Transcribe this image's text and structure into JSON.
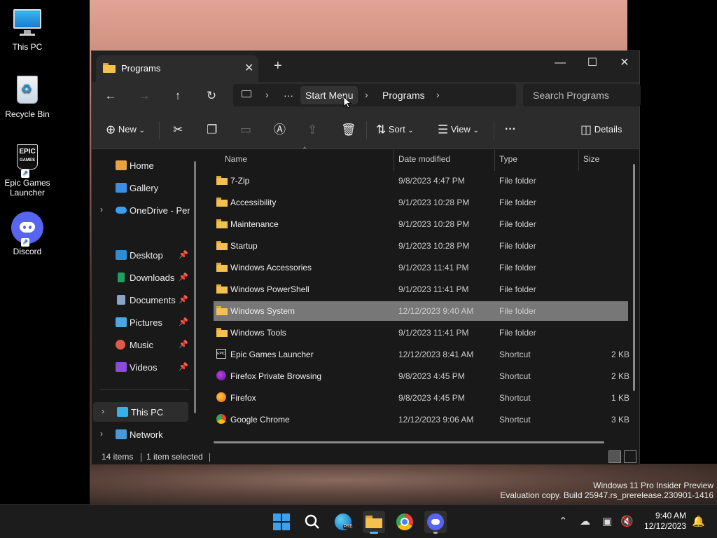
{
  "desktop": {
    "icons": [
      {
        "label": "This PC"
      },
      {
        "label": "Recycle Bin"
      },
      {
        "label": "Epic Games Launcher"
      },
      {
        "label": "Discord"
      }
    ]
  },
  "window": {
    "tab_title": "Programs",
    "new_tab": "+",
    "controls": {
      "minimize": "—",
      "maximize": "☐",
      "close": "✕"
    },
    "address": {
      "ellipsis": "···",
      "segments": [
        "Start Menu",
        "Programs"
      ]
    },
    "search_placeholder": "Search Programs",
    "toolbar": {
      "new_label": "New",
      "sort_label": "Sort",
      "view_label": "View",
      "more_label": "···",
      "details_label": "Details"
    },
    "nav": {
      "quick": [
        {
          "label": "Home"
        },
        {
          "label": "Gallery"
        },
        {
          "label": "OneDrive - Personal"
        }
      ],
      "pinned": [
        {
          "label": "Desktop"
        },
        {
          "label": "Downloads"
        },
        {
          "label": "Documents"
        },
        {
          "label": "Pictures"
        },
        {
          "label": "Music"
        },
        {
          "label": "Videos"
        }
      ],
      "devices": [
        {
          "label": "This PC"
        },
        {
          "label": "Network"
        }
      ]
    },
    "columns": {
      "name": "Name",
      "date": "Date modified",
      "type": "Type",
      "size": "Size"
    },
    "files": [
      {
        "name": "7-Zip",
        "date": "9/8/2023 4:47 PM",
        "type": "File folder",
        "size": ""
      },
      {
        "name": "Accessibility",
        "date": "9/1/2023 10:28 PM",
        "type": "File folder",
        "size": ""
      },
      {
        "name": "Maintenance",
        "date": "9/1/2023 10:28 PM",
        "type": "File folder",
        "size": ""
      },
      {
        "name": "Startup",
        "date": "9/1/2023 10:28 PM",
        "type": "File folder",
        "size": ""
      },
      {
        "name": "Windows Accessories",
        "date": "9/1/2023 11:41 PM",
        "type": "File folder",
        "size": ""
      },
      {
        "name": "Windows PowerShell",
        "date": "9/1/2023 11:41 PM",
        "type": "File folder",
        "size": ""
      },
      {
        "name": "Windows System",
        "date": "12/12/2023 9:40 AM",
        "type": "File folder",
        "size": ""
      },
      {
        "name": "Windows Tools",
        "date": "9/1/2023 11:41 PM",
        "type": "File folder",
        "size": ""
      },
      {
        "name": "Epic Games Launcher",
        "date": "12/12/2023 8:41 AM",
        "type": "Shortcut",
        "size": "2 KB"
      },
      {
        "name": "Firefox Private Browsing",
        "date": "9/8/2023 4:45 PM",
        "type": "Shortcut",
        "size": "2 KB"
      },
      {
        "name": "Firefox",
        "date": "9/8/2023 4:45 PM",
        "type": "Shortcut",
        "size": "1 KB"
      },
      {
        "name": "Google Chrome",
        "date": "12/12/2023 9:06 AM",
        "type": "Shortcut",
        "size": "3 KB"
      }
    ],
    "status": {
      "count": "14 items",
      "selection": "1 item selected"
    }
  },
  "watermark": {
    "line1": "Windows 11 Pro Insider Preview",
    "line2": "Evaluation copy. Build 25947.rs_prerelease.230901-1416"
  },
  "taskbar": {
    "time": "9:40 AM",
    "date": "12/12/2023"
  },
  "colors": {
    "folder": "#f2c14e",
    "selection": "#777777",
    "accent": "#0078d4"
  }
}
